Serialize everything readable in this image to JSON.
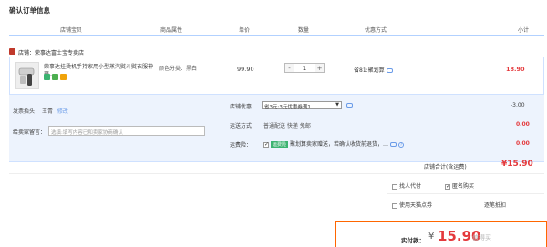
{
  "page": {
    "title": "确认订单信息"
  },
  "table_header": {
    "shop_item": "店铺宝贝",
    "attributes": "商品属性",
    "unit_price": "单价",
    "quantity": "数量",
    "promo": "优惠方式",
    "subtotal": "小计"
  },
  "shop": {
    "label": "店铺：荣事达富士宝专卖店"
  },
  "item": {
    "name": "荣事达挂烫机手持家用小型蒸汽熨斗熨衣服神器…",
    "attributes": "颜色分类：黑白",
    "price": "99.90",
    "quantity": "1",
    "minus": "-",
    "plus": "+",
    "promo": "省81:聚划算",
    "subtotal": "18.90"
  },
  "invoice": {
    "label": "发票抬头：",
    "value": "王青",
    "action": "修改"
  },
  "message": {
    "label": "给卖家留言：",
    "placeholder": "选填:填写内容已和卖家协商确认"
  },
  "shop_promo": {
    "label": "店铺优惠：",
    "selected": "省3元:3元优惠券满1",
    "amount": "-3.00"
  },
  "shipping": {
    "label": "运送方式：",
    "value": "普通配送 快递 免邮",
    "amount": "0.00"
  },
  "insurance": {
    "label": "运费险：",
    "tag": "运费险",
    "value": "聚划算卖家赠送，若确认收货前退货，…",
    "amount": "0.00"
  },
  "shop_total": {
    "label": "店铺合计(含运费)",
    "amount": "¥15.90"
  },
  "options": {
    "pay_for_me": "找人代付",
    "anonymous": "匿名购买",
    "tmall_points": "使用天猫点券",
    "deduct": "逐笔抵扣"
  },
  "payment": {
    "label": "实付款：",
    "currency": "¥",
    "amount": "15.90"
  },
  "watermark": {
    "text": "值得买"
  },
  "colors": {
    "accent_red": "#e4393c",
    "header_line": "#b2d1ff",
    "panel_bg": "#edf3fd",
    "pay_border": "#ff6600"
  }
}
